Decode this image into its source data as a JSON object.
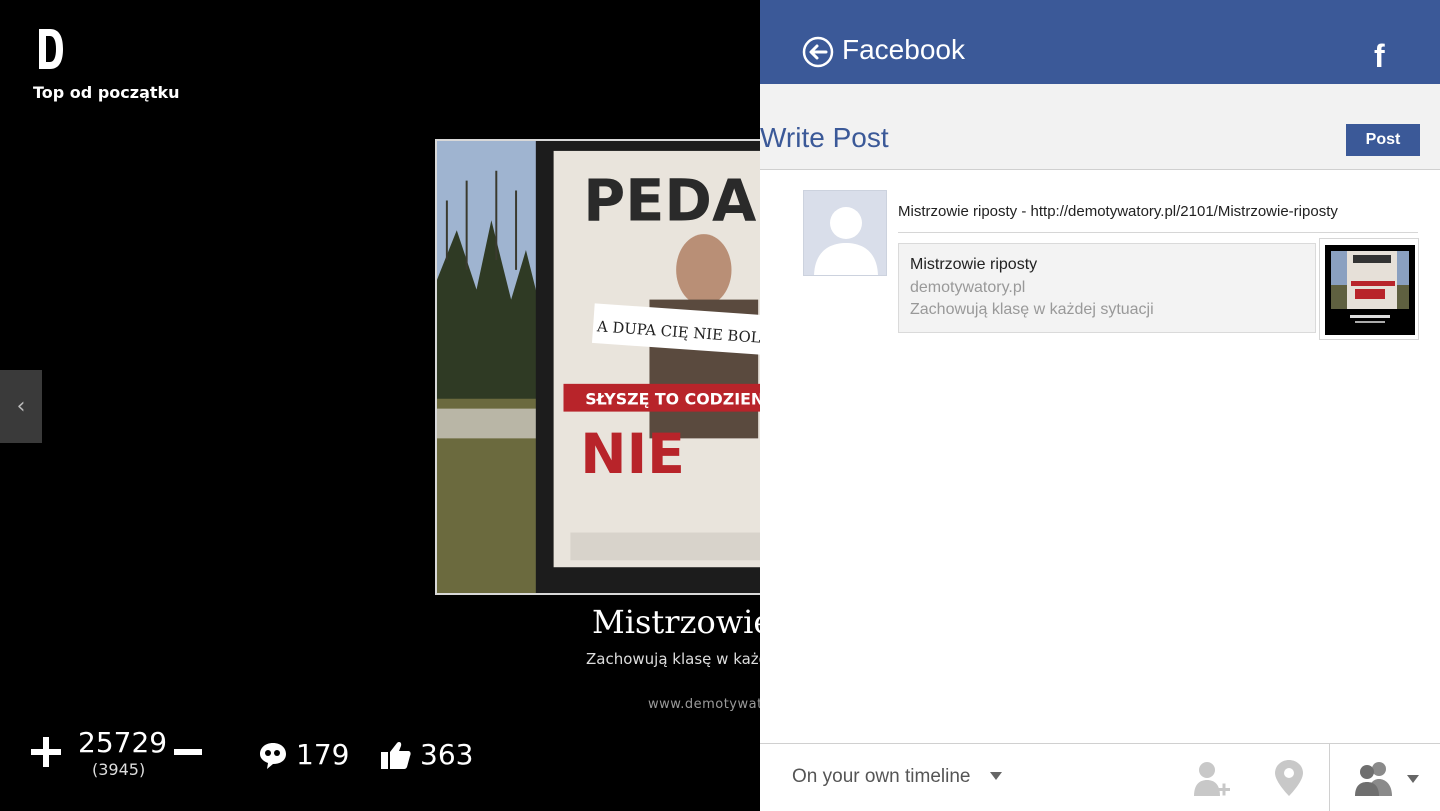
{
  "app": {
    "section_title": "Top od początku",
    "post": {
      "title": "Mistrzowie riposty",
      "subtitle": "Zachowują klasę w każdej sytuacji",
      "watermark": "www.demotywatory.pl",
      "sign_text_top": "PEDA",
      "sign_paper": "A DUPA CIĘ NIE BOLI",
      "sign_banner": "SŁYSZĘ TO CODZIENNIE",
      "sign_bottom": "NIE"
    },
    "votes": {
      "score": "25729",
      "sub": "(3945)"
    },
    "comments_count": "179",
    "likes_count": "363"
  },
  "facebook": {
    "header_title": "Facebook",
    "subtitle": "Write Post",
    "post_button": "Post",
    "post_text": "Mistrzowie riposty - http://demotywatory.pl/2101/Mistrzowie-riposty",
    "link": {
      "title": "Mistrzowie riposty",
      "domain": "demotywatory.pl",
      "description": "Zachowują klasę w każdej sytuacji"
    },
    "audience": "On your own timeline"
  },
  "colors": {
    "facebook_blue": "#3b5998",
    "background": "#000000"
  },
  "icons": [
    "app-logo-icon",
    "back-arrow-icon",
    "facebook-logo-icon",
    "plus-icon",
    "minus-icon",
    "comment-icon",
    "thumbs-up-icon",
    "tag-friends-icon",
    "location-pin-icon",
    "privacy-friends-icon"
  ]
}
